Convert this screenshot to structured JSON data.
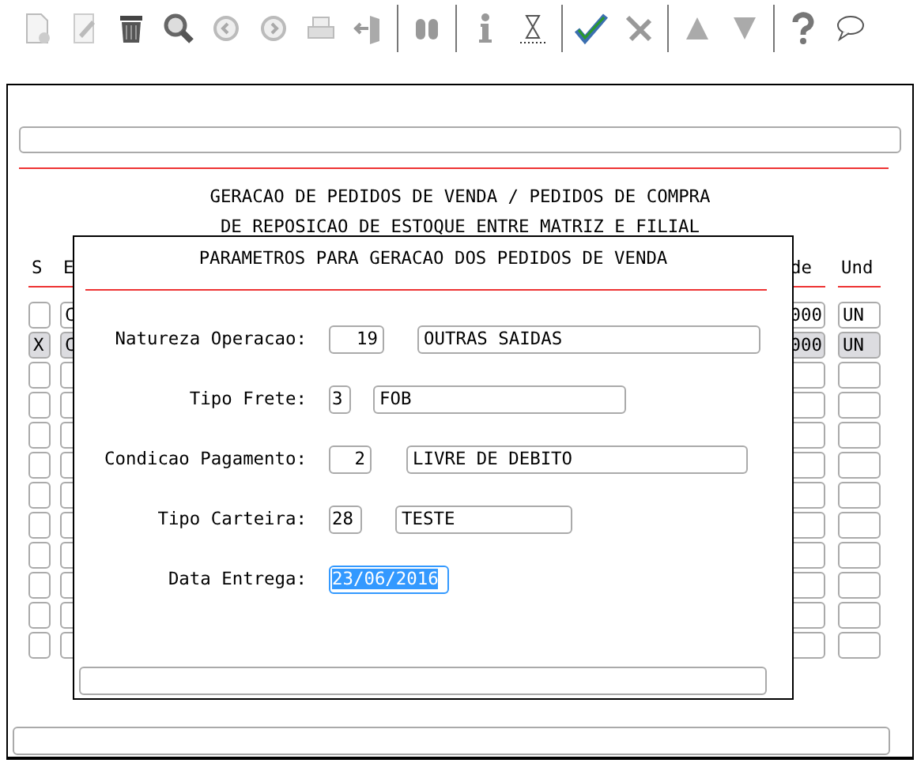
{
  "header": {
    "lines": [
      "GERACAO DE PEDIDOS DE VENDA / PEDIDOS DE COMPRA",
      "DE REPOSICAO DE ESTOQUE ENTRE MATRIZ E FILIAL"
    ]
  },
  "table": {
    "columns": [
      "S",
      "E",
      "de",
      "Und"
    ],
    "rows": [
      {
        "selected": false,
        "s": "",
        "column_2": "C",
        "column_3": "000",
        "und": "UN"
      },
      {
        "selected": true,
        "s": "X",
        "column_2": "C",
        "column_3": "000",
        "und": "UN"
      },
      {
        "selected": false
      },
      {
        "selected": false
      },
      {
        "selected": false
      },
      {
        "selected": false
      },
      {
        "selected": false
      },
      {
        "selected": false
      },
      {
        "selected": false
      },
      {
        "selected": false
      },
      {
        "selected": false
      },
      {
        "selected": false
      }
    ]
  },
  "dialog": {
    "title": "PARAMETROS PARA GERACAO DOS PEDIDOS DE VENDA",
    "fields": [
      {
        "label": "Natureza Operacao:",
        "code": "19",
        "description": "OUTRAS SAIDAS"
      },
      {
        "label": "Tipo Frete:",
        "code": "3",
        "description": "FOB"
      },
      {
        "label": "Condicao Pagamento:",
        "code": "2",
        "description": "LIVRE DE DEBITO"
      },
      {
        "label": "Tipo Carteira:",
        "code": "28",
        "description": "TESTE"
      },
      {
        "label": "Data Entrega:",
        "code": "23/06/2016",
        "focused": true
      }
    ]
  }
}
